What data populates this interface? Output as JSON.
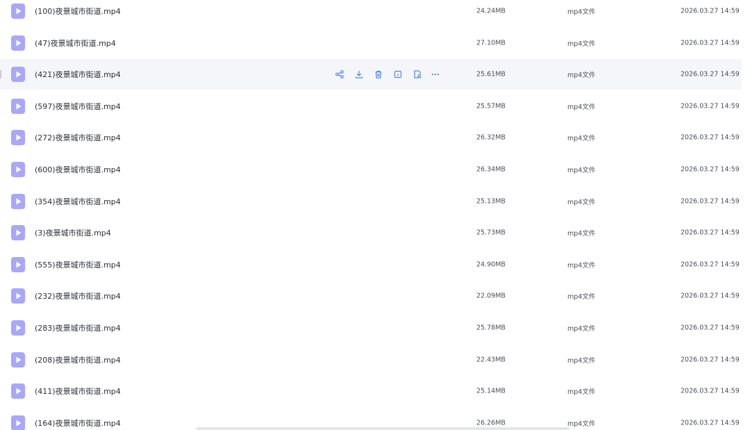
{
  "files": [
    {
      "name": "(100)夜景城市街道.mp4",
      "size": "24.24MB",
      "type": "mp4文件",
      "date": "2026.03.27 14:59"
    },
    {
      "name": "(47)夜景城市街道.mp4",
      "size": "27.10MB",
      "type": "mp4文件",
      "date": "2026.03.27 14:59"
    },
    {
      "name": "(421)夜景城市街道.mp4",
      "size": "25.61MB",
      "type": "mp4文件",
      "date": "2026.03.27 14:59",
      "hovered": true
    },
    {
      "name": "(597)夜景城市街道.mp4",
      "size": "25.57MB",
      "type": "mp4文件",
      "date": "2026.03.27 14:59"
    },
    {
      "name": "(272)夜景城市街道.mp4",
      "size": "26.32MB",
      "type": "mp4文件",
      "date": "2026.03.27 14:59"
    },
    {
      "name": "(600)夜景城市街道.mp4",
      "size": "26.34MB",
      "type": "mp4文件",
      "date": "2026.03.27 14:59"
    },
    {
      "name": "(354)夜景城市街道.mp4",
      "size": "25.13MB",
      "type": "mp4文件",
      "date": "2026.03.27 14:59"
    },
    {
      "name": "(3)夜景城市街道.mp4",
      "size": "25.73MB",
      "type": "mp4文件",
      "date": "2026.03.27 14:59"
    },
    {
      "name": "(555)夜景城市街道.mp4",
      "size": "24.90MB",
      "type": "mp4文件",
      "date": "2026.03.27 14:59"
    },
    {
      "name": "(232)夜景城市街道.mp4",
      "size": "22.09MB",
      "type": "mp4文件",
      "date": "2026.03.27 14:59"
    },
    {
      "name": "(283)夜景城市街道.mp4",
      "size": "25.78MB",
      "type": "mp4文件",
      "date": "2026.03.27 14:59"
    },
    {
      "name": "(208)夜景城市街道.mp4",
      "size": "22.43MB",
      "type": "mp4文件",
      "date": "2026.03.27 14:59"
    },
    {
      "name": "(411)夜景城市街道.mp4",
      "size": "25.14MB",
      "type": "mp4文件",
      "date": "2026.03.27 14:59"
    },
    {
      "name": "(164)夜景城市街道.mp4",
      "size": "26.26MB",
      "type": "mp4文件",
      "date": "2026.03.27 14:59"
    }
  ],
  "row_actions": [
    {
      "icon": "share-icon"
    },
    {
      "icon": "download-icon"
    },
    {
      "icon": "delete-icon"
    },
    {
      "icon": "info-icon"
    },
    {
      "icon": "preview-icon"
    },
    {
      "icon": "more-icon"
    }
  ],
  "colors": {
    "file_icon": "#a9a7f9",
    "action_icon": "#4a88e8",
    "hover_row": "#f5f6fa"
  }
}
